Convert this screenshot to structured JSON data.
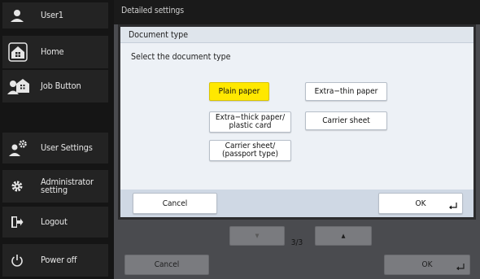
{
  "sidebar": {
    "user": {
      "label": "User1",
      "icon": "user-icon"
    },
    "items": [
      {
        "label": "Home",
        "icon": "home-icon"
      },
      {
        "label": "Job Button",
        "icon": "job-button-icon"
      },
      {
        "label": "User Settings",
        "icon": "user-settings-icon"
      },
      {
        "label": "Administrator\nsetting",
        "icon": "gear-icon"
      },
      {
        "label": "Logout",
        "icon": "logout-icon"
      },
      {
        "label": "Power off",
        "icon": "power-icon"
      }
    ]
  },
  "main": {
    "title": "Detailed settings",
    "page_indicator": "3/3",
    "cancel_label": "Cancel",
    "ok_label": "OK"
  },
  "dialog": {
    "title": "Document type",
    "prompt": "Select the document type",
    "options": [
      {
        "label": "Plain paper",
        "selected": true
      },
      {
        "label": "Extra−thin paper",
        "selected": false
      },
      {
        "label": "Extra−thick paper/\nplastic card",
        "selected": false
      },
      {
        "label": "Carrier sheet",
        "selected": false
      },
      {
        "label": "Carrier sheet/\n(passport type)",
        "selected": false
      }
    ],
    "cancel_label": "Cancel",
    "ok_label": "OK"
  },
  "colors": {
    "selected": "#ffe800",
    "sidebar_bg": "#151515",
    "dialog_border": "#2c2c2e"
  }
}
